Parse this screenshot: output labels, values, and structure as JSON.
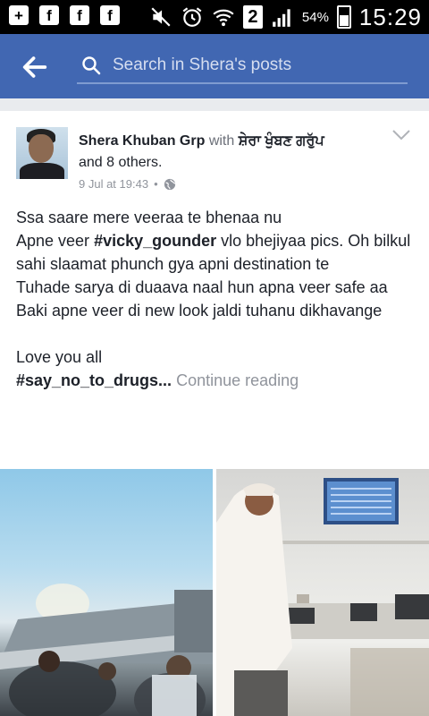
{
  "status_bar": {
    "signal_box_label": "2",
    "battery_percent": "54%",
    "time": "15:29"
  },
  "app_bar": {
    "search_placeholder": "Search in Shera's posts"
  },
  "post": {
    "author": "Shera Khuban Grp",
    "with_word": "with",
    "tagged_name": "ਸ਼ੇਰਾ ਖੁੰਬਣ ਗਰੁੱਪ",
    "others": "and 8 others.",
    "timestamp": "9 Jul at 19:43",
    "separator": "•",
    "body_lines": [
      {
        "pre": "Ssa saare mere veeraa te bhenaa nu",
        "tag": "",
        "post": ""
      },
      {
        "pre": "Apne veer ",
        "tag": "#vicky_gounder",
        "post": " vlo bhejiyaa pics. Oh bilkul sahi slaamat phunch gya apni destination te"
      },
      {
        "pre": "Tuhade sarya di duaava naal hun apna veer safe aa",
        "tag": "",
        "post": ""
      },
      {
        "pre": "Baki apne veer di new look jaldi tuhanu dikhavange",
        "tag": "",
        "post": ""
      }
    ],
    "love_line": "Love you all",
    "final_tag": "#say_no_to_drugs...",
    "continue_reading": "Continue reading"
  },
  "colors": {
    "app_bar": "#4167b2",
    "status_bar": "#000000",
    "text_primary": "#1d2129",
    "text_muted": "#90949c"
  }
}
